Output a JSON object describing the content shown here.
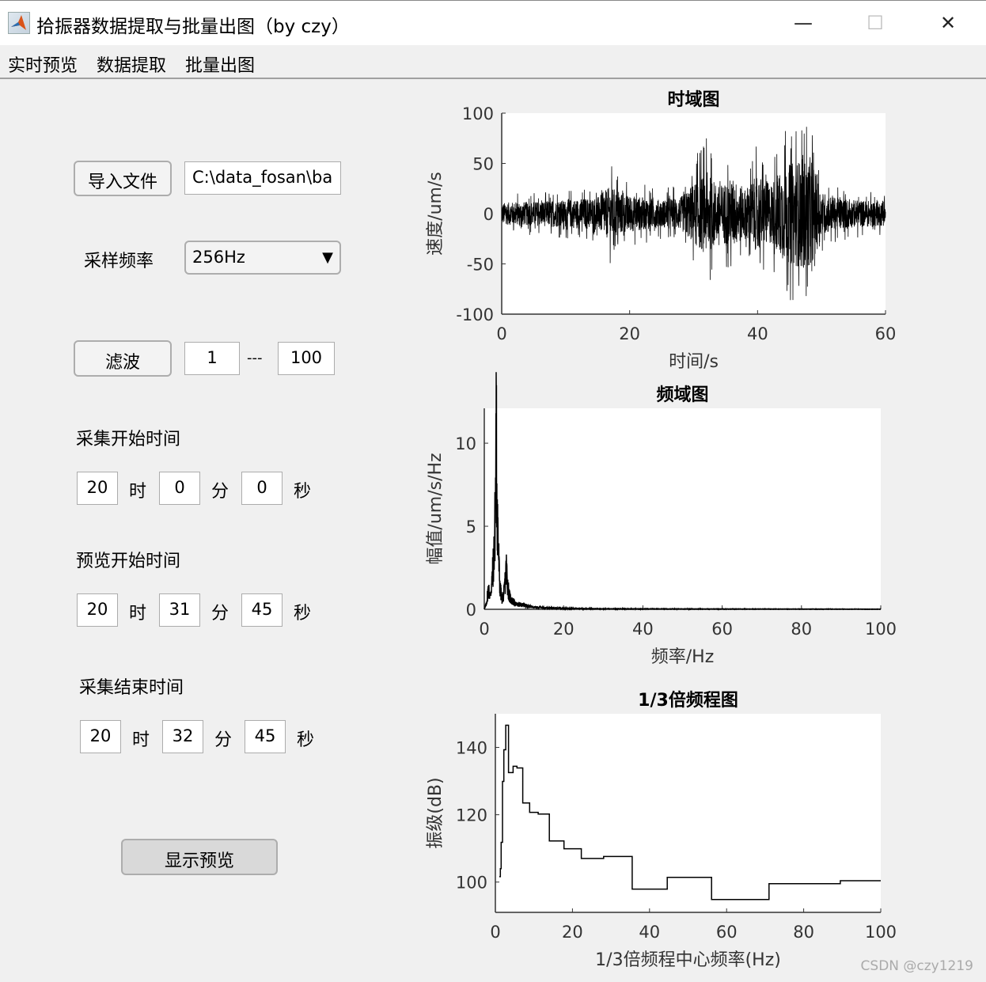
{
  "window": {
    "title": "拾振器数据提取与批量出图（by czy）",
    "minimize": "—",
    "maximize": "☐",
    "close": "✕"
  },
  "menu": [
    "实时预览",
    "数据提取",
    "批量出图"
  ],
  "controls": {
    "import_button": "导入文件",
    "file_path": "C:\\data_fosan\\ba",
    "sample_rate_label": "采样频率",
    "sample_rate_value": "256Hz",
    "dropdown_arrow": "▼",
    "filter_button": "滤波",
    "filter_low": "1",
    "filter_sep": "---",
    "filter_high": "100",
    "units": {
      "h": "时",
      "m": "分",
      "s": "秒"
    },
    "start": {
      "label": "采集开始时间",
      "h": "20",
      "m": "0",
      "s": "0"
    },
    "preview": {
      "label": "预览开始时间",
      "h": "20",
      "m": "31",
      "s": "45"
    },
    "end": {
      "label": "采集结束时间",
      "h": "20",
      "m": "32",
      "s": "45"
    },
    "show_button": "显示预览"
  },
  "watermark": "CSDN @czy1219",
  "chart_data": [
    {
      "type": "line",
      "title": "时域图",
      "xlabel": "时间/s",
      "ylabel": "速度/um/s",
      "xlim": [
        0,
        60
      ],
      "ylim": [
        -100,
        100
      ],
      "xticks": [
        "0",
        "20",
        "40",
        "60"
      ],
      "yticks": [
        "100",
        "50",
        "0",
        "-50",
        "-100"
      ],
      "envelope": {
        "t": [
          0,
          5,
          10,
          15,
          17,
          19,
          22,
          25,
          28,
          30,
          32,
          34,
          36,
          38,
          40,
          42,
          44,
          46,
          47,
          48,
          49,
          50,
          52,
          55,
          60
        ],
        "amp": [
          20,
          22,
          25,
          30,
          50,
          35,
          30,
          25,
          30,
          55,
          75,
          50,
          65,
          45,
          70,
          55,
          85,
          95,
          100,
          95,
          80,
          40,
          30,
          25,
          22
        ]
      }
    },
    {
      "type": "line",
      "title": "频域图",
      "xlabel": "频率/Hz",
      "ylabel": "幅值/um/s/Hz",
      "xlim": [
        0,
        100
      ],
      "ylim": [
        0,
        12.1
      ],
      "xticks": [
        "0",
        "20",
        "40",
        "60",
        "80",
        "100"
      ],
      "yticks": [
        "0",
        "5",
        "10"
      ],
      "x": [
        0,
        0.5,
        1,
        1.5,
        2,
        2.5,
        2.8,
        3,
        3.2,
        3.5,
        3.8,
        4,
        4.5,
        5,
        5.3,
        5.6,
        5.9,
        6.3,
        7,
        8,
        10,
        12,
        15,
        20,
        30,
        50,
        100
      ],
      "y": [
        0,
        0.3,
        1.2,
        0.8,
        1.8,
        3.5,
        6,
        10.6,
        7,
        4,
        2,
        1.2,
        0.6,
        1,
        1.8,
        2.5,
        1.5,
        0.8,
        0.5,
        0.3,
        0.25,
        0.15,
        0.1,
        0.05,
        0.03,
        0.02,
        0.01
      ]
    },
    {
      "type": "line",
      "title": "1/3倍频程图",
      "xlabel": "1/3倍频程中心频率(Hz)",
      "ylabel": "振级(dB)",
      "xlim": [
        0,
        100
      ],
      "ylim": [
        91,
        150
      ],
      "xticks": [
        "0",
        "20",
        "40",
        "60",
        "80",
        "100"
      ],
      "yticks": [
        "100",
        "120",
        "140"
      ],
      "edges": [
        1.0,
        1.3,
        1.5,
        1.85,
        2.2,
        2.7,
        3.4,
        4.6,
        5.6,
        7.1,
        8.9,
        11.1,
        14.0,
        17.8,
        22.3,
        28.1,
        35.5,
        44.6,
        56.1,
        71.0,
        89.5,
        100
      ],
      "levels": [
        101.6,
        104,
        111.8,
        129.9,
        139.3,
        146.6,
        132.5,
        134.4,
        133.9,
        123.5,
        120.7,
        120.2,
        112.2,
        109.9,
        107,
        107.6,
        97.9,
        101.4,
        94.8,
        99.5,
        100.4
      ]
    }
  ]
}
